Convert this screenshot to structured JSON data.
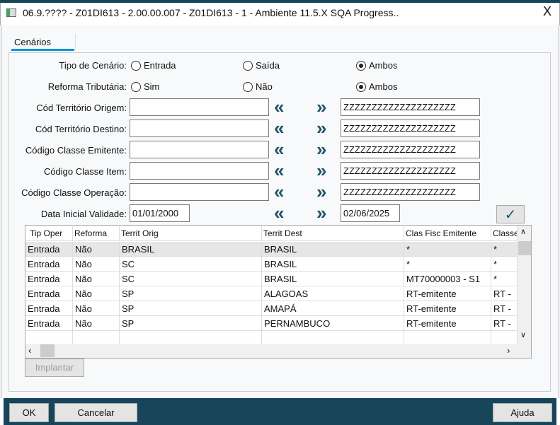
{
  "window": {
    "title": "06.9.???? - Z01DI613 - 2.00.00.007 - Z01DI613 - 1 - Ambiente 11.5.X SQA Progress..",
    "close": "X"
  },
  "tab": "Cenários",
  "tipo": {
    "label": "Tipo de Cenário:",
    "options": [
      "Entrada",
      "Saída",
      "Ambos"
    ],
    "selected": "Ambos"
  },
  "reforma": {
    "label": "Reforma Tributária:",
    "options": [
      "Sim",
      "Não",
      "Ambos"
    ],
    "selected": "Ambos"
  },
  "ranges": [
    {
      "label": "Cód Território Origem:",
      "from": "",
      "to": "ZZZZZZZZZZZZZZZZZZZZ"
    },
    {
      "label": "Cód Território Destino:",
      "from": "",
      "to": "ZZZZZZZZZZZZZZZZZZZZ"
    },
    {
      "label": "Código Classe Emitente:",
      "from": "",
      "to": "ZZZZZZZZZZZZZZZZZZZZ"
    },
    {
      "label": "Código Classe Item:",
      "from": "",
      "to": "ZZZZZZZZZZZZZZZZZZZZ"
    },
    {
      "label": "Código Classe Operação:",
      "from": "",
      "to": "ZZZZZZZZZZZZZZZZZZZZ"
    },
    {
      "label": "Data Inicial Validade:",
      "from": "01/01/2000",
      "to": "02/06/2025"
    }
  ],
  "arrows": {
    "first": "«",
    "last": "»"
  },
  "check": "✓",
  "grid": {
    "columns": [
      "Tip Oper",
      "Reforma",
      "Territ Orig",
      "Territ Dest",
      "Clas Fisc Emitente",
      "Classe"
    ],
    "rows": [
      [
        "Entrada",
        "Não",
        "BRASIL",
        "BRASIL",
        "*",
        "*"
      ],
      [
        "Entrada",
        "Não",
        "SC",
        "BRASIL",
        "*",
        "*"
      ],
      [
        "Entrada",
        "Não",
        "SC",
        "BRASIL",
        "MT70000003 - S1",
        "*"
      ],
      [
        "Entrada",
        "Não",
        "SP",
        "ALAGOAS",
        "RT-emitente",
        "RT -"
      ],
      [
        "Entrada",
        "Não",
        "SP",
        "AMAPÁ",
        "RT-emitente",
        "RT -"
      ],
      [
        "Entrada",
        "Não",
        "SP",
        "PERNAMBUCO",
        "RT-emitente",
        "RT -"
      ]
    ]
  },
  "buttons": {
    "implantar": "Implantar",
    "ok": "OK",
    "cancelar": "Cancelar",
    "ajuda": "Ajuda"
  }
}
